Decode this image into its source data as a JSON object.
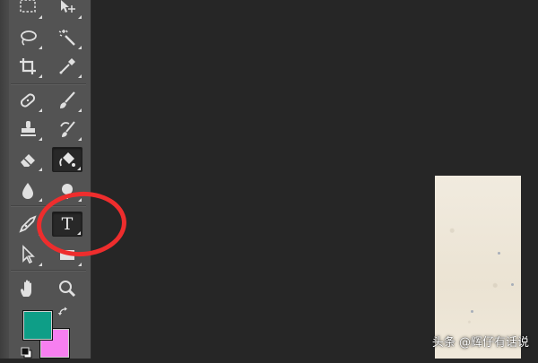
{
  "toolbar": {
    "tools": [
      {
        "id": "marquee",
        "icon": "rect-marquee-icon"
      },
      {
        "id": "move",
        "icon": "move-icon"
      },
      {
        "id": "lasso",
        "icon": "lasso-icon"
      },
      {
        "id": "magic-wand",
        "icon": "magic-wand-icon"
      },
      {
        "id": "crop",
        "icon": "crop-icon"
      },
      {
        "id": "eyedropper",
        "icon": "eyedropper-icon"
      },
      {
        "id": "healing-brush",
        "icon": "bandage-icon"
      },
      {
        "id": "brush",
        "icon": "brush-icon"
      },
      {
        "id": "clone-stamp",
        "icon": "stamp-icon"
      },
      {
        "id": "history-brush",
        "icon": "history-brush-icon"
      },
      {
        "id": "eraser",
        "icon": "eraser-icon"
      },
      {
        "id": "paint-bucket",
        "icon": "paint-bucket-icon",
        "active": true
      },
      {
        "id": "blur",
        "icon": "drop-icon"
      },
      {
        "id": "dodge",
        "icon": "dodge-icon"
      },
      {
        "id": "pen",
        "icon": "pen-icon"
      },
      {
        "id": "type",
        "icon": "type-icon",
        "glyph": "T",
        "active": true
      },
      {
        "id": "path-selection",
        "icon": "arrow-pointer-icon"
      },
      {
        "id": "shape",
        "icon": "rectangle-icon"
      },
      {
        "id": "hand",
        "icon": "hand-icon"
      },
      {
        "id": "zoom",
        "icon": "zoom-icon"
      }
    ],
    "foreground_color": "#0e9e87",
    "background_color": "#f77ff0"
  },
  "annotation": {
    "color": "#ee2d2d"
  },
  "watermark": {
    "text": "头条 @辉仔有话说"
  }
}
